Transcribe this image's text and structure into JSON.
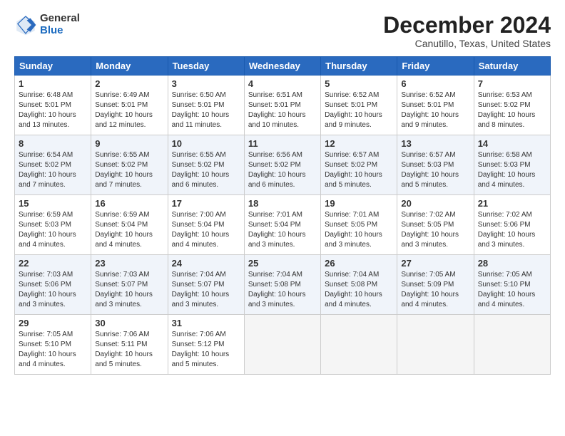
{
  "header": {
    "logo_general": "General",
    "logo_blue": "Blue",
    "month_title": "December 2024",
    "location": "Canutillo, Texas, United States"
  },
  "weekdays": [
    "Sunday",
    "Monday",
    "Tuesday",
    "Wednesday",
    "Thursday",
    "Friday",
    "Saturday"
  ],
  "weeks": [
    [
      {
        "num": "1",
        "info": "Sunrise: 6:48 AM\nSunset: 5:01 PM\nDaylight: 10 hours\nand 13 minutes."
      },
      {
        "num": "2",
        "info": "Sunrise: 6:49 AM\nSunset: 5:01 PM\nDaylight: 10 hours\nand 12 minutes."
      },
      {
        "num": "3",
        "info": "Sunrise: 6:50 AM\nSunset: 5:01 PM\nDaylight: 10 hours\nand 11 minutes."
      },
      {
        "num": "4",
        "info": "Sunrise: 6:51 AM\nSunset: 5:01 PM\nDaylight: 10 hours\nand 10 minutes."
      },
      {
        "num": "5",
        "info": "Sunrise: 6:52 AM\nSunset: 5:01 PM\nDaylight: 10 hours\nand 9 minutes."
      },
      {
        "num": "6",
        "info": "Sunrise: 6:52 AM\nSunset: 5:01 PM\nDaylight: 10 hours\nand 9 minutes."
      },
      {
        "num": "7",
        "info": "Sunrise: 6:53 AM\nSunset: 5:02 PM\nDaylight: 10 hours\nand 8 minutes."
      }
    ],
    [
      {
        "num": "8",
        "info": "Sunrise: 6:54 AM\nSunset: 5:02 PM\nDaylight: 10 hours\nand 7 minutes."
      },
      {
        "num": "9",
        "info": "Sunrise: 6:55 AM\nSunset: 5:02 PM\nDaylight: 10 hours\nand 7 minutes."
      },
      {
        "num": "10",
        "info": "Sunrise: 6:55 AM\nSunset: 5:02 PM\nDaylight: 10 hours\nand 6 minutes."
      },
      {
        "num": "11",
        "info": "Sunrise: 6:56 AM\nSunset: 5:02 PM\nDaylight: 10 hours\nand 6 minutes."
      },
      {
        "num": "12",
        "info": "Sunrise: 6:57 AM\nSunset: 5:02 PM\nDaylight: 10 hours\nand 5 minutes."
      },
      {
        "num": "13",
        "info": "Sunrise: 6:57 AM\nSunset: 5:03 PM\nDaylight: 10 hours\nand 5 minutes."
      },
      {
        "num": "14",
        "info": "Sunrise: 6:58 AM\nSunset: 5:03 PM\nDaylight: 10 hours\nand 4 minutes."
      }
    ],
    [
      {
        "num": "15",
        "info": "Sunrise: 6:59 AM\nSunset: 5:03 PM\nDaylight: 10 hours\nand 4 minutes."
      },
      {
        "num": "16",
        "info": "Sunrise: 6:59 AM\nSunset: 5:04 PM\nDaylight: 10 hours\nand 4 minutes."
      },
      {
        "num": "17",
        "info": "Sunrise: 7:00 AM\nSunset: 5:04 PM\nDaylight: 10 hours\nand 4 minutes."
      },
      {
        "num": "18",
        "info": "Sunrise: 7:01 AM\nSunset: 5:04 PM\nDaylight: 10 hours\nand 3 minutes."
      },
      {
        "num": "19",
        "info": "Sunrise: 7:01 AM\nSunset: 5:05 PM\nDaylight: 10 hours\nand 3 minutes."
      },
      {
        "num": "20",
        "info": "Sunrise: 7:02 AM\nSunset: 5:05 PM\nDaylight: 10 hours\nand 3 minutes."
      },
      {
        "num": "21",
        "info": "Sunrise: 7:02 AM\nSunset: 5:06 PM\nDaylight: 10 hours\nand 3 minutes."
      }
    ],
    [
      {
        "num": "22",
        "info": "Sunrise: 7:03 AM\nSunset: 5:06 PM\nDaylight: 10 hours\nand 3 minutes."
      },
      {
        "num": "23",
        "info": "Sunrise: 7:03 AM\nSunset: 5:07 PM\nDaylight: 10 hours\nand 3 minutes."
      },
      {
        "num": "24",
        "info": "Sunrise: 7:04 AM\nSunset: 5:07 PM\nDaylight: 10 hours\nand 3 minutes."
      },
      {
        "num": "25",
        "info": "Sunrise: 7:04 AM\nSunset: 5:08 PM\nDaylight: 10 hours\nand 3 minutes."
      },
      {
        "num": "26",
        "info": "Sunrise: 7:04 AM\nSunset: 5:08 PM\nDaylight: 10 hours\nand 4 minutes."
      },
      {
        "num": "27",
        "info": "Sunrise: 7:05 AM\nSunset: 5:09 PM\nDaylight: 10 hours\nand 4 minutes."
      },
      {
        "num": "28",
        "info": "Sunrise: 7:05 AM\nSunset: 5:10 PM\nDaylight: 10 hours\nand 4 minutes."
      }
    ],
    [
      {
        "num": "29",
        "info": "Sunrise: 7:05 AM\nSunset: 5:10 PM\nDaylight: 10 hours\nand 4 minutes."
      },
      {
        "num": "30",
        "info": "Sunrise: 7:06 AM\nSunset: 5:11 PM\nDaylight: 10 hours\nand 5 minutes."
      },
      {
        "num": "31",
        "info": "Sunrise: 7:06 AM\nSunset: 5:12 PM\nDaylight: 10 hours\nand 5 minutes."
      },
      null,
      null,
      null,
      null
    ]
  ]
}
